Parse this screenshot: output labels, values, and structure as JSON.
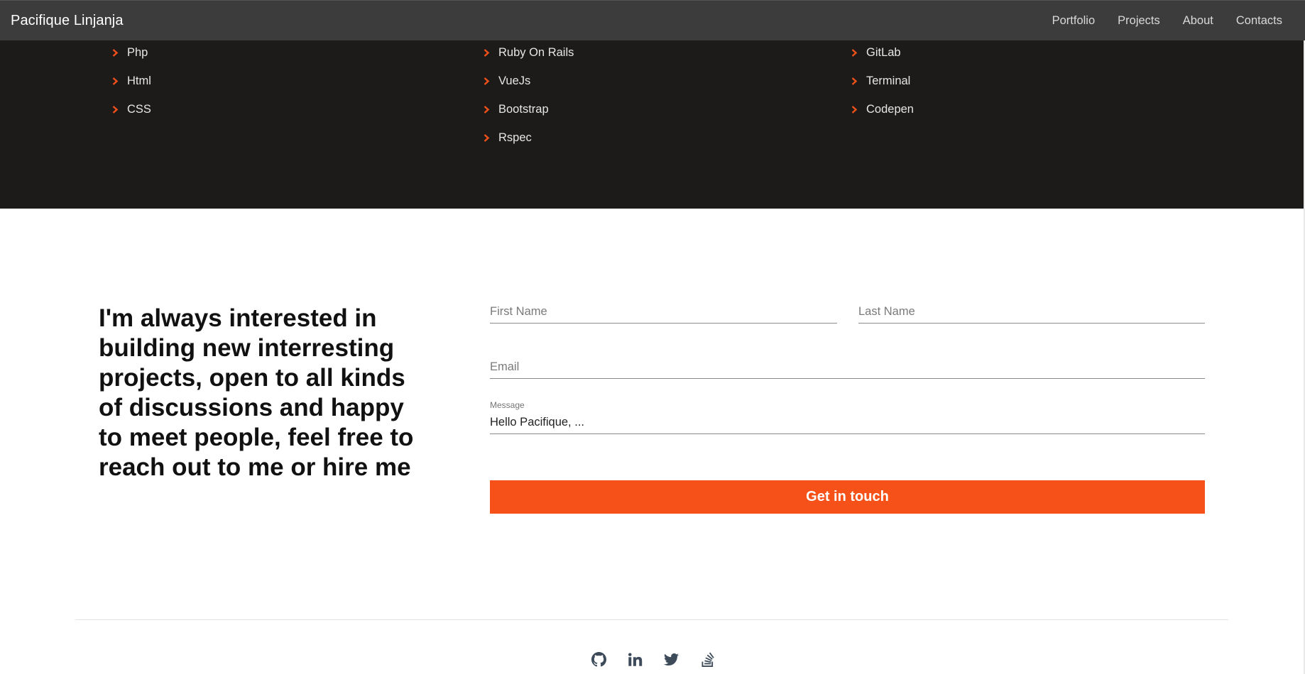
{
  "navbar": {
    "brand": "Pacifique Linjanja",
    "links": [
      "Portfolio",
      "Projects",
      "About",
      "Contacts"
    ]
  },
  "skills": {
    "columns": [
      [
        "Php",
        "Html",
        "CSS"
      ],
      [
        "Ruby On Rails",
        "VueJs",
        "Bootstrap",
        "Rspec"
      ],
      [
        "GitLab",
        "Terminal",
        "Codepen"
      ]
    ]
  },
  "contact": {
    "pitch": "I'm always interested in building new interresting projects, open to all kinds of discussions and happy to meet people, feel free to reach out to me or hire me",
    "first_name_placeholder": "First Name",
    "last_name_placeholder": "Last Name",
    "email_placeholder": "Email",
    "message_label": "Message",
    "message_value": "Hello Pacifique, ...",
    "submit_label": "Get in touch"
  },
  "footer": {
    "social_icons": [
      "github-icon",
      "linkedin-icon",
      "twitter-icon",
      "stackoverflow-icon"
    ]
  },
  "colors": {
    "accent": "#f55118",
    "navbar_bg": "#3d3c3c",
    "skills_bg": "#1c1b1a"
  }
}
